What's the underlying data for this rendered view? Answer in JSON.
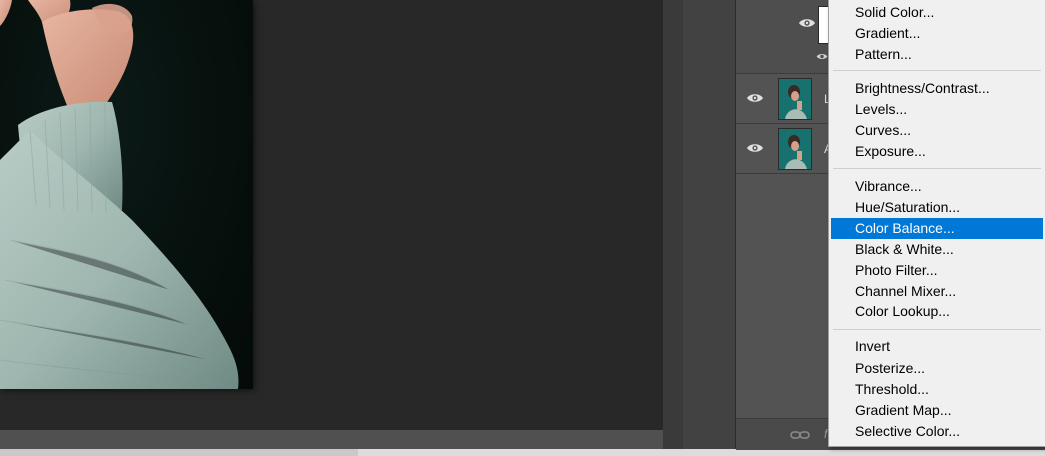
{
  "menu": {
    "groups": [
      [
        "Solid Color...",
        "Gradient...",
        "Pattern..."
      ],
      [
        "Brightness/Contrast...",
        "Levels...",
        "Curves...",
        "Exposure..."
      ],
      [
        "Vibrance...",
        "Hue/Saturation...",
        "Color Balance...",
        "Black & White...",
        "Photo Filter...",
        "Channel Mixer...",
        "Color Lookup..."
      ],
      [
        "Invert",
        "Posterize...",
        "Threshold...",
        "Gradient Map...",
        "Selective Color..."
      ]
    ],
    "selected": "Color Balance...",
    "colors": {
      "highlight": "#0078d7",
      "background": "#f0f0f0"
    }
  },
  "layers": {
    "rows": [
      {
        "type": "adjustment",
        "visible": true
      },
      {
        "type": "image",
        "name_fragment": "L",
        "visible": true
      },
      {
        "type": "image",
        "name_fragment": "A",
        "visible": true
      }
    ],
    "footer": {
      "icons": [
        "link-icon",
        "fx-icon"
      ],
      "fx_fragment": "f"
    }
  },
  "canvas": {
    "background": "#282828",
    "photo_subject": "woman-in-knit-sweater"
  }
}
